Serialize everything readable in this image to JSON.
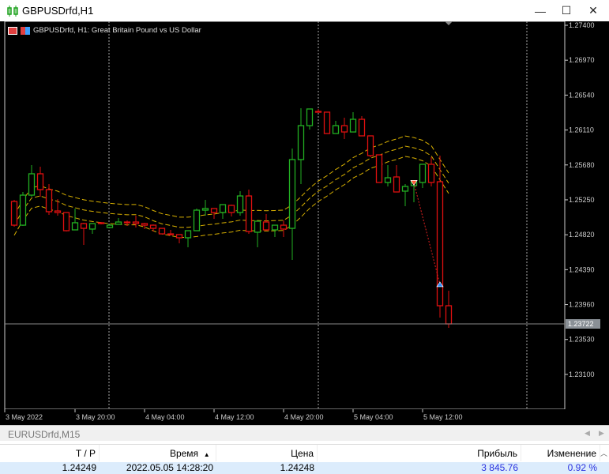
{
  "window": {
    "title": "GBPUSDrfd,H1",
    "minimize": "—",
    "maximize": "☐",
    "close": "✕"
  },
  "chart": {
    "legend": "GBPUSDrfd, H1:  Great Britain Pound vs US Dollar",
    "current_price_label": "1.23722",
    "price_labels": [
      "1.27400",
      "1.26970",
      "1.26540",
      "1.26110",
      "1.25680",
      "1.25250",
      "1.24820",
      "1.24390",
      "1.23960",
      "1.23530",
      "1.23100"
    ],
    "time_labels": [
      "3 May 2022",
      "3 May 20:00",
      "4 May 04:00",
      "4 May 12:00",
      "4 May 20:00",
      "5 May 04:00",
      "5 May 12:00"
    ]
  },
  "chart_data": {
    "type": "candlestick",
    "symbol": "GBPUSDrfd",
    "timeframe": "H1",
    "ylim": [
      1.226,
      1.2745
    ],
    "price_ticks": [
      1.274,
      1.2697,
      1.2654,
      1.2611,
      1.2568,
      1.2525,
      1.2482,
      1.2439,
      1.2396,
      1.2353,
      1.231
    ],
    "current_price": 1.23722,
    "colors": {
      "up": "#22b022",
      "down": "#e01010",
      "envelope": "#d8b000",
      "grid": "#888888"
    },
    "envelope": {
      "period": 14,
      "deviation_pct": 0.1
    },
    "ohlc": [
      [
        1.2523,
        1.2525,
        1.24919,
        1.24938
      ],
      [
        1.24938,
        1.25347,
        1.24929,
        1.25308
      ],
      [
        1.25308,
        1.25678,
        1.25289,
        1.25571
      ],
      [
        1.25571,
        1.25658,
        1.25289,
        1.25376
      ],
      [
        1.25376,
        1.25444,
        1.25065,
        1.25104
      ],
      [
        1.25113,
        1.25259,
        1.25055,
        1.25094
      ],
      [
        1.25094,
        1.25094,
        1.2486,
        1.2487
      ],
      [
        1.2488,
        1.25143,
        1.2488,
        1.24968
      ],
      [
        1.24958,
        1.24968,
        1.24695,
        1.24899
      ],
      [
        1.2489,
        1.24958,
        1.24831,
        1.24958
      ],
      [
        1.24968,
        1.24977,
        1.24948,
        1.24958
      ],
      [
        1.24909,
        1.24948,
        1.24899,
        1.24938
      ],
      [
        1.24948,
        1.25026,
        1.24948,
        1.24977
      ],
      [
        1.24977,
        1.24997,
        1.24929,
        1.24968
      ],
      [
        1.24977,
        1.25055,
        1.24909,
        1.24958
      ],
      [
        1.24958,
        1.24968,
        1.2489,
        1.24938
      ],
      [
        1.24938,
        1.24948,
        1.2486,
        1.24899
      ],
      [
        1.24899,
        1.24899,
        1.24831,
        1.24831
      ],
      [
        1.24831,
        1.2488,
        1.24812,
        1.24822
      ],
      [
        1.24822,
        1.24822,
        1.24715,
        1.24783
      ],
      [
        1.24783,
        1.2487,
        1.24666,
        1.2487
      ],
      [
        1.2487,
        1.25143,
        1.2487,
        1.25123
      ],
      [
        1.25123,
        1.2525,
        1.25055,
        1.25143
      ],
      [
        1.25143,
        1.25143,
        1.25016,
        1.25094
      ],
      [
        1.25094,
        1.25191,
        1.25016,
        1.25191
      ],
      [
        1.25182,
        1.25191,
        1.25045,
        1.25094
      ],
      [
        1.25094,
        1.25357,
        1.25055,
        1.25298
      ],
      [
        1.25298,
        1.25376,
        1.24831,
        1.2486
      ],
      [
        1.24851,
        1.24987,
        1.24666,
        1.24987
      ],
      [
        1.24977,
        1.25075,
        1.2487,
        1.2488
      ],
      [
        1.2488,
        1.24938,
        1.24792,
        1.24938
      ],
      [
        1.24938,
        1.24997,
        1.24792,
        1.2489
      ],
      [
        1.24899,
        1.25882,
        1.2451,
        1.25746
      ],
      [
        1.25746,
        1.26378,
        1.25444,
        1.26164
      ],
      [
        1.26164,
        1.26369,
        1.26116,
        1.26369
      ],
      [
        1.26339,
        1.26369,
        1.2633,
        1.2633
      ],
      [
        1.2633,
        1.2633,
        1.26067,
        1.26067
      ],
      [
        1.26067,
        1.26223,
        1.26067,
        1.26164
      ],
      [
        1.26164,
        1.26262,
        1.25999,
        1.26086
      ],
      [
        1.26086,
        1.2633,
        1.26086,
        1.26242
      ],
      [
        1.26242,
        1.26281,
        1.26038,
        1.26038
      ],
      [
        1.26038,
        1.26038,
        1.25775,
        1.25795
      ],
      [
        1.25804,
        1.25804,
        1.25464,
        1.25464
      ],
      [
        1.25464,
        1.25678,
        1.25415,
        1.25522
      ],
      [
        1.25532,
        1.25678,
        1.25347,
        1.25347
      ],
      [
        1.25357,
        1.25444,
        1.25172,
        1.25415
      ],
      [
        1.25425,
        1.25473,
        1.2522,
        1.25473
      ],
      [
        1.25464,
        1.25688,
        1.25396,
        1.25688
      ],
      [
        1.25688,
        1.25775,
        1.25415,
        1.25464
      ],
      [
        1.25473,
        1.25795,
        1.238,
        1.23946
      ],
      [
        1.23946,
        1.24131,
        1.23673,
        1.23722
      ]
    ],
    "day_separators_at_index": [
      11,
      35,
      59
    ],
    "trades": [
      {
        "type": "sell",
        "index": 46,
        "price": 1.2546
      },
      {
        "type": "buy",
        "index": 49,
        "price": 1.24209
      }
    ]
  },
  "bottom_panel": {
    "tab": "EURUSDrfd,M15",
    "columns": [
      "T / P",
      "Время",
      "Цена",
      "Прибыль",
      "Изменение"
    ],
    "sort_indicator": "▲",
    "row": {
      "tp": "1.24249",
      "time": "2022.05.05 14:28:20",
      "price": "1.24248",
      "profit": "3 845.76",
      "change": "0.92 %"
    }
  }
}
